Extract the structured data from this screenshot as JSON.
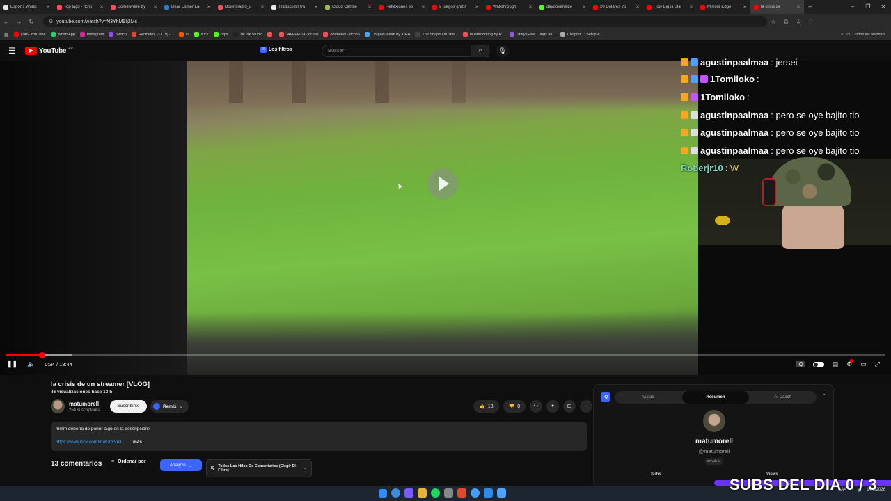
{
  "browser": {
    "tabs": [
      {
        "label": "Esports World",
        "color": "#e8e8e8"
      },
      {
        "label": "Top tags - itch.i",
        "color": "#ff4d55"
      },
      {
        "label": "Somewhere by",
        "color": "#ff4d55"
      },
      {
        "label": "Dear Esther La",
        "color": "#2d7dd2"
      },
      {
        "label": "Download 0_u",
        "color": "#ff4d55"
      },
      {
        "label": "Traducción fra",
        "color": "#e8e8e8"
      },
      {
        "label": "Cloud Climbe",
        "color": "#9bbd5a"
      },
      {
        "label": "Reflexiones so",
        "color": "#ff0000"
      },
      {
        "label": "9 juegos gratis",
        "color": "#ff0000"
      },
      {
        "label": "Walkthrough",
        "color": "#ff0000"
      },
      {
        "label": "davooxeneize",
        "color": "#53fc18"
      },
      {
        "label": "20 Dólares Yo",
        "color": "#ff0000"
      },
      {
        "label": "How Big is Bla",
        "color": "#ff0000"
      },
      {
        "label": "Mirrors Edge",
        "color": "#ff0000"
      },
      {
        "label": "la crisis de",
        "color": "#ff0000"
      }
    ],
    "new_tab": "+",
    "window_controls": [
      "–",
      "❐",
      "✕"
    ],
    "url": "youtube.com/watch?v=N3YhM9Ij2Ms",
    "bookmarks": [
      {
        "label": "(146) YouTube",
        "color": "#ff0000"
      },
      {
        "label": "WhatsApp",
        "color": "#25d366"
      },
      {
        "label": "Instagram",
        "color": "#d6249f"
      },
      {
        "label": "Twitch",
        "color": "#9146ff"
      },
      {
        "label": "Recibidos (3.119) -...",
        "color": "#ea4335"
      },
      {
        "label": "sc",
        "color": "#ff5500"
      },
      {
        "label": "Kick",
        "color": "#53fc18"
      },
      {
        "label": "clips",
        "color": "#53fc18"
      },
      {
        "label": "TikTok Studio",
        "color": "#222222"
      },
      {
        "label": "",
        "color": "#ff4d55"
      },
      {
        "label": "IAFFEFCH - itch.io",
        "color": "#ff4d55"
      },
      {
        "label": "oddnerve - itch.io",
        "color": "#ff4d55"
      },
      {
        "label": "CorpseOcean by KIRA",
        "color": "#3ea6ff"
      },
      {
        "label": "The Shape On The...",
        "color": "#444444"
      },
      {
        "label": "Mushrooming by R...",
        "color": "#ff4d55"
      },
      {
        "label": "They Grew Lungs an...",
        "color": "#8c5bd6"
      },
      {
        "label": "Chapter 1: Setup &...",
        "color": "#aaaaaa"
      }
    ],
    "bookmarks_more": "»",
    "all_bookmarks": "Todos los favoritos"
  },
  "youtube": {
    "logo_text": "YouTube",
    "logo_sup": "AR",
    "filters_label": "Los filtros",
    "search_placeholder": "Buscar",
    "create_label": "Crear"
  },
  "player": {
    "current_time": "0:34",
    "duration": "13:44",
    "time_display": "0:34 / 13:44",
    "progress_fraction": 0.0413,
    "buffer_fraction": 0.0757
  },
  "chat": [
    {
      "user": "agustinpaalmaa",
      "msg": ": jersei",
      "color": "#ffffff",
      "msg_color": "#ffffff"
    },
    {
      "user": "1Tomiloko",
      "msg": ":",
      "color": "#ffffff",
      "msg_color": "#ffffff"
    },
    {
      "user": "1Tomiloko",
      "msg": ":",
      "color": "#ffffff",
      "msg_color": "#ffffff"
    },
    {
      "user": "agustinpaalmaa",
      "msg": ": pero se oye bajito tio",
      "color": "#ffffff",
      "msg_color": "#ffffff"
    },
    {
      "user": "agustinpaalmaa",
      "msg": ": pero se oye bajito tio",
      "color": "#ffffff",
      "msg_color": "#ffffff"
    },
    {
      "user": "agustinpaalmaa",
      "msg": ": pero se oye bajito tio",
      "color": "#ffffff",
      "msg_color": "#ffffff"
    },
    {
      "user": "Roberjr10",
      "msg": ": W",
      "color": "#7fd3c2",
      "msg_color": "#e8d74a"
    }
  ],
  "video": {
    "title": "la crisis de un streamer [VLOG]",
    "views": "46 visualizaciones",
    "age": "hace 13 h",
    "channel_name": "matumorell",
    "channel_subs": "254 suscriptores",
    "subscribe_label": "Suscribirse",
    "remix_label": "Remix",
    "likes": "18",
    "dislikes": "0",
    "description": "mmm debería de poner algo en la descripción?",
    "description_link": "https://www.kick.com/matumorell",
    "more_label": "más"
  },
  "comments": {
    "count_label": "13 comentarios",
    "sort_label": "Ordenar por",
    "analyze_label": "Analyze",
    "threads_label": "Todos Los Hilos De Comentarios (Elegir El Filtro)"
  },
  "panel": {
    "logo": "IQ",
    "tabs": [
      "Vistas",
      "Resumen",
      "AI Coach"
    ],
    "active_tab": 1,
    "channel_name": "matumorell",
    "handle": "@matumorell",
    "videos_badge": "87 videos",
    "subs_label": "Subs",
    "views_label": "Views"
  },
  "stream_overlay": {
    "subs_goal": "SUBS DEL DIA 0 / 3"
  },
  "taskbar": {
    "lang": "LAA",
    "time": "",
    "date": "14/8/2026",
    "app_colors": [
      "#3a8dde",
      "#7a5af8",
      "#e8b339",
      "#1ed760",
      "#888888",
      "#e04a2f",
      "#44a0ff",
      "#2b8ce6",
      "#4da3ff"
    ]
  },
  "colors": {
    "youtube_red": "#ff0000",
    "accent_blue": "#3b66ff",
    "link_blue": "#3ea6ff"
  }
}
